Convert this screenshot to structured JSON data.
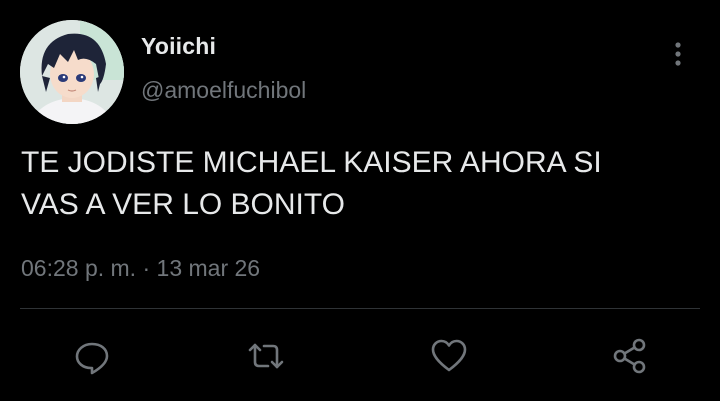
{
  "tweet": {
    "author": {
      "display_name": "Yoiichi",
      "handle": "@amoelfuchibol"
    },
    "text": "TE JODISTE MICHAEL KAISER AHORA SI\nVAS A VER LO BONITO",
    "time": "06:28 p. m.",
    "separator": "·",
    "date": "13 mar 26"
  },
  "actions": [
    "reply-icon",
    "retweet-icon",
    "like-icon",
    "share-icon"
  ],
  "colors": {
    "background": "#000000",
    "primary_text": "#e7e9ea",
    "secondary_text": "#71767b",
    "divider": "#2f3336"
  }
}
